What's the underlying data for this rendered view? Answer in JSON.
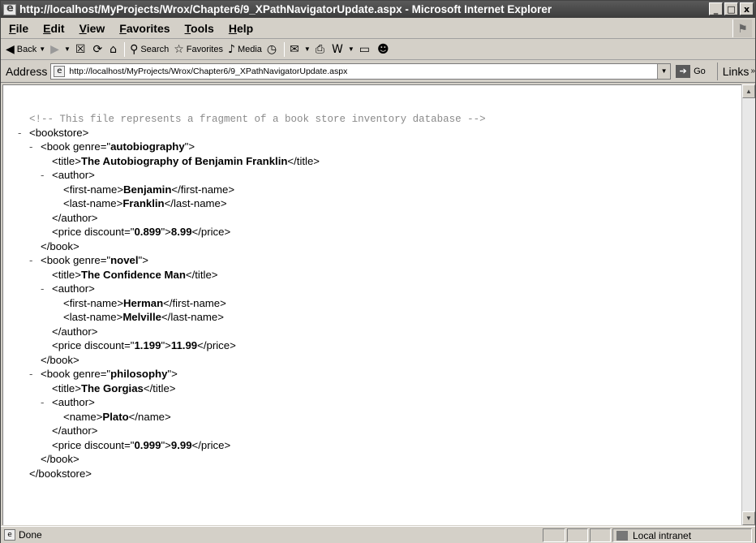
{
  "window": {
    "title": "http://localhost/MyProjects/Wrox/Chapter6/9_XPathNavigatorUpdate.aspx - Microsoft Internet Explorer",
    "minimize": "_",
    "maximize": "□",
    "close": "x"
  },
  "menu": [
    "File",
    "Edit",
    "View",
    "Favorites",
    "Tools",
    "Help"
  ],
  "toolbar": {
    "back": "Back",
    "search": "Search",
    "favorites": "Favorites",
    "media": "Media"
  },
  "address": {
    "label": "Address",
    "url": "http://localhost/MyProjects/Wrox/Chapter6/9_XPathNavigatorUpdate.aspx",
    "go": "Go",
    "links": "Links"
  },
  "xml": {
    "comment": "<!-- This file represents a fragment of a book store inventory database -->",
    "bookstore_open": "<bookstore>",
    "bookstore_close": "</bookstore>",
    "books": [
      {
        "genre": "autobiography",
        "title": "The Autobiography of Benjamin Franklin",
        "first_name": "Benjamin",
        "last_name": "Franklin",
        "discount": "0.899",
        "price": "8.99"
      },
      {
        "genre": "novel",
        "title": "The Confidence Man",
        "first_name": "Herman",
        "last_name": "Melville",
        "discount": "1.199",
        "price": "11.99"
      },
      {
        "genre": "philosophy",
        "title": "The Gorgias",
        "name": "Plato",
        "discount": "0.999",
        "price": "9.99"
      }
    ]
  },
  "status": {
    "text": "Done",
    "zone": "Local intranet"
  }
}
